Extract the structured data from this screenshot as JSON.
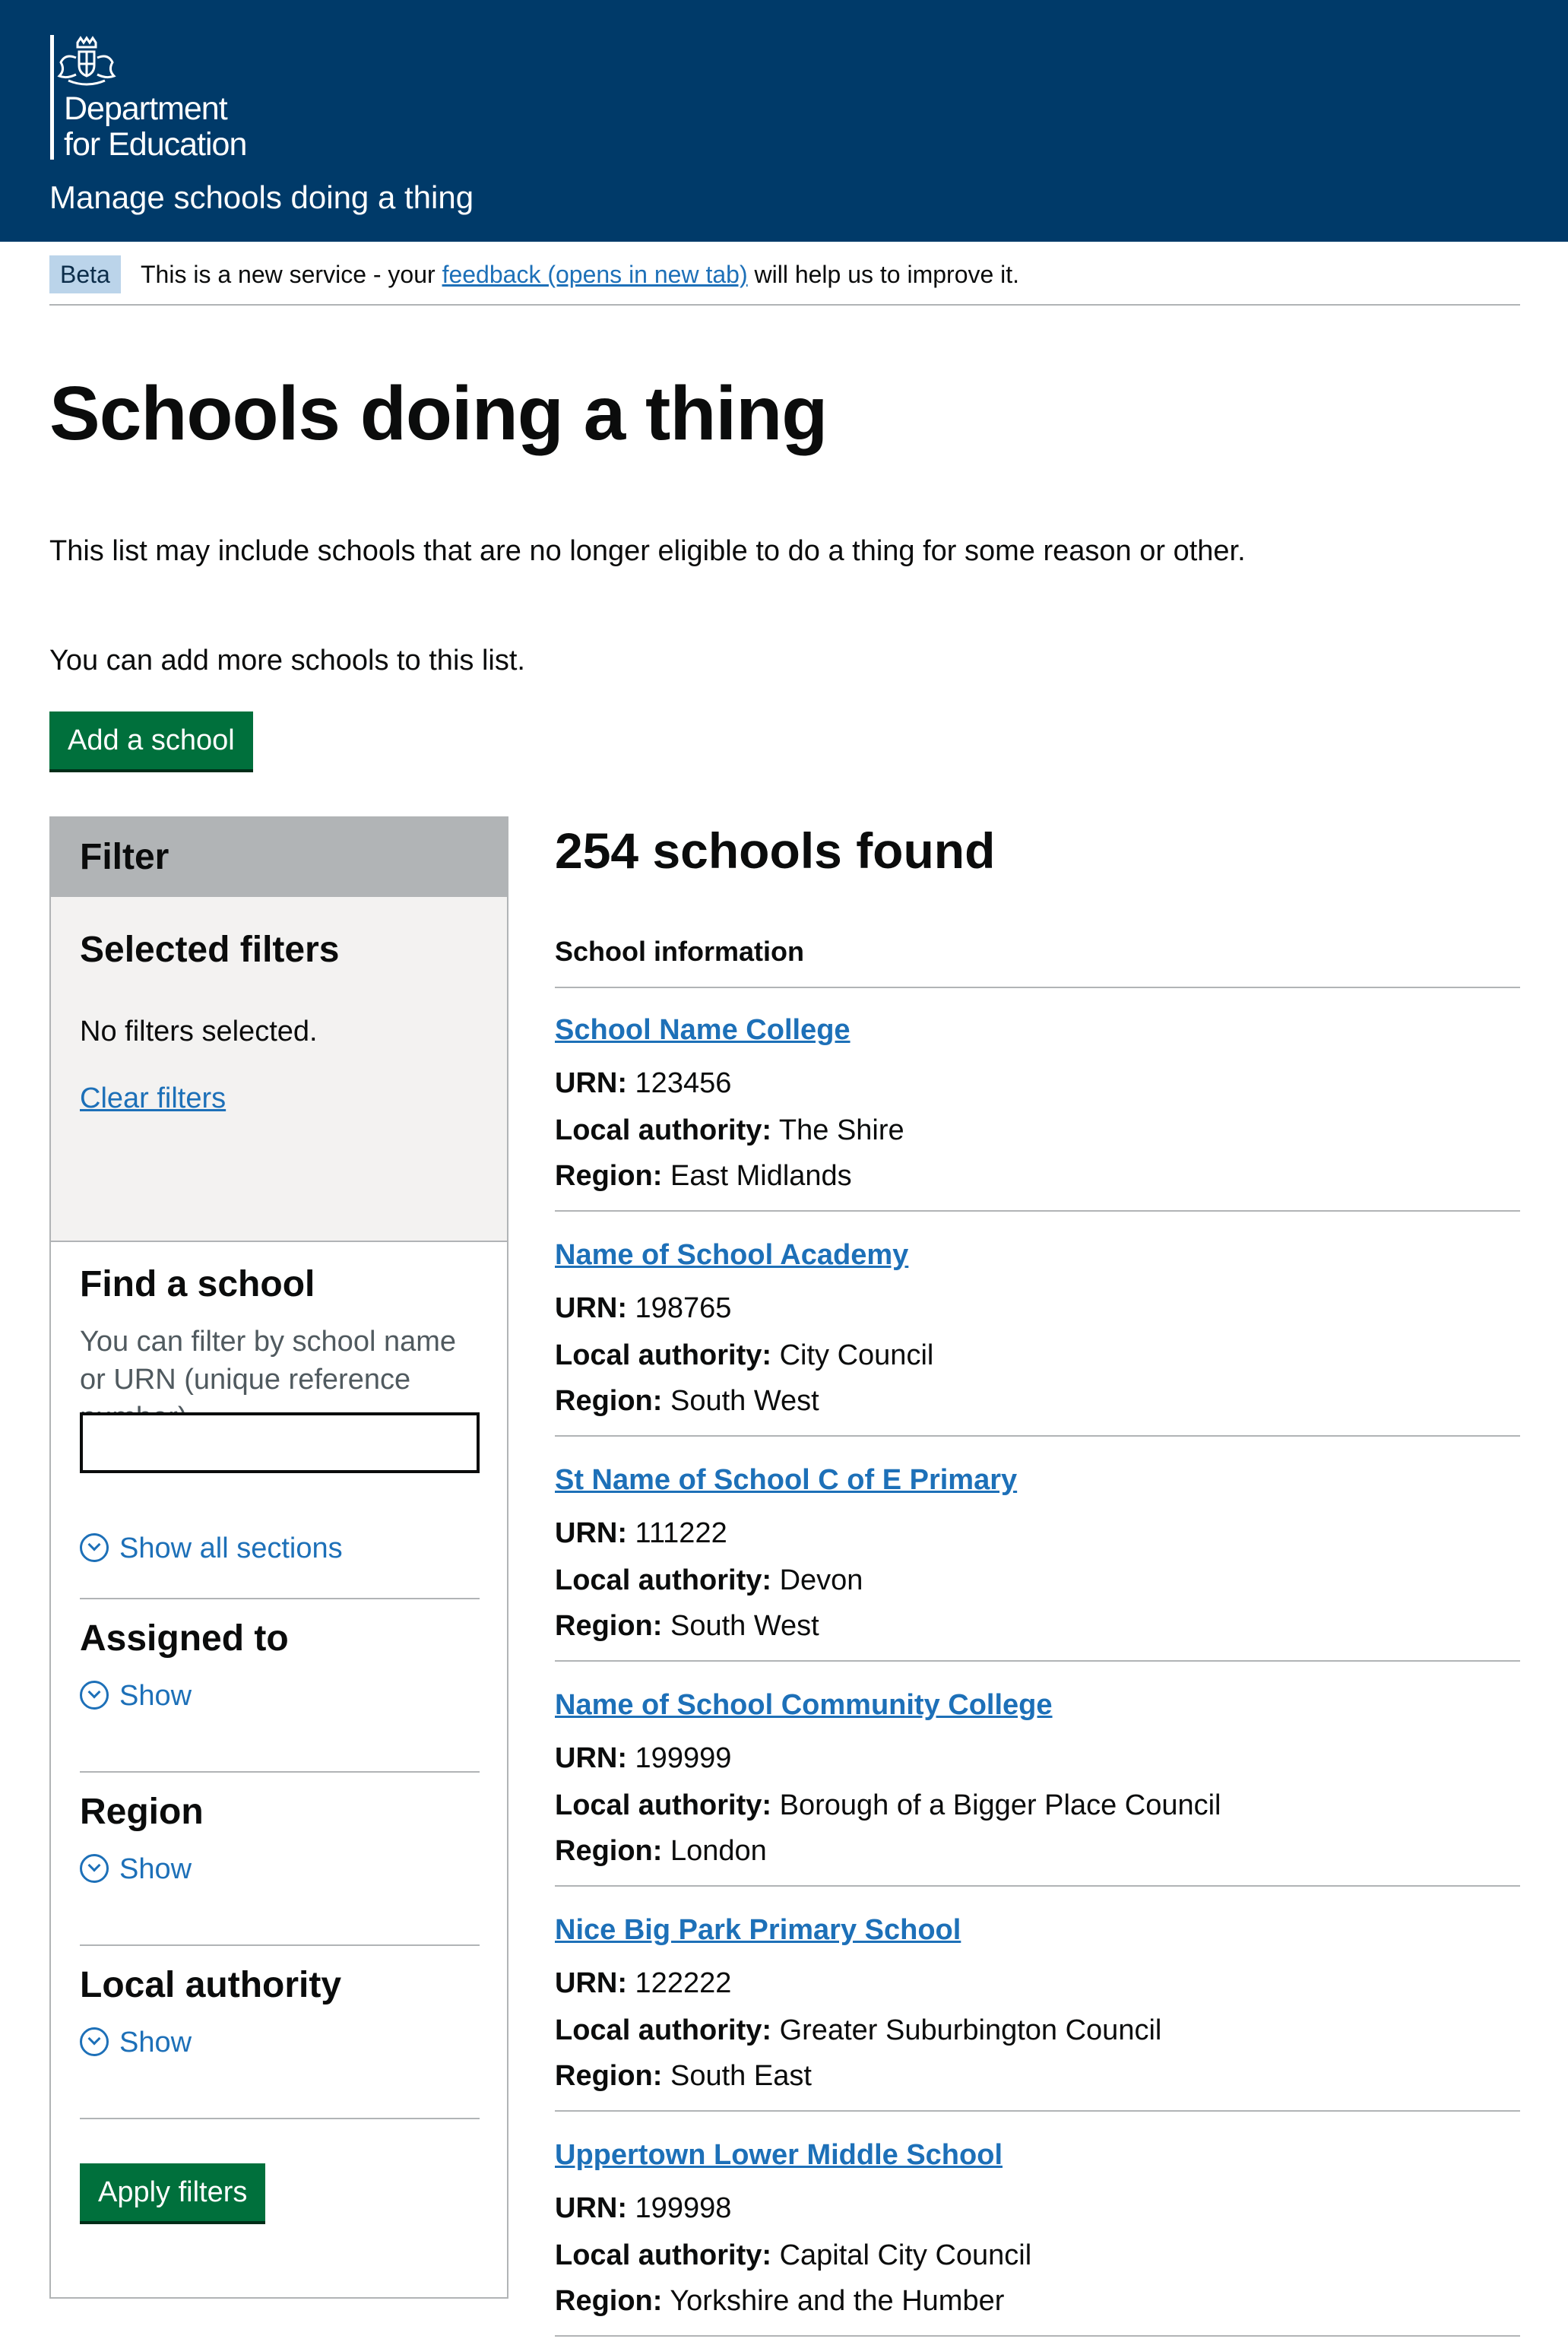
{
  "header": {
    "department_line1": "Department",
    "department_line2": "for Education",
    "service_name": "Manage schools doing a thing"
  },
  "beta": {
    "tag": "Beta",
    "text_before": "This is a new service - your ",
    "link": "feedback (opens in new tab)",
    "text_after": " will help us to improve it."
  },
  "page": {
    "title": "Schools doing a thing",
    "intro": "This list may include schools that are no longer eligible to do a thing for some reason or other.",
    "intro2": "You can add more schools to this list.",
    "add_button": "Add a school"
  },
  "filter": {
    "heading": "Filter",
    "selected_heading": "Selected filters",
    "no_filters": "No filters selected.",
    "clear_link": "Clear filters",
    "find_title": "Find a school",
    "find_hint": "You can filter by school name or URN (unique reference number).",
    "find_value": "",
    "show_all": "Show all sections",
    "sections": [
      {
        "title": "Assigned to",
        "toggle": "Show"
      },
      {
        "title": "Region",
        "toggle": "Show"
      },
      {
        "title": "Local authority",
        "toggle": "Show"
      }
    ],
    "apply_button": "Apply filters"
  },
  "results": {
    "count_heading": "254 schools found",
    "column_header": "School information",
    "labels": {
      "urn": "URN:",
      "la": "Local authority:",
      "region": "Region:"
    },
    "items": [
      {
        "name": "School Name College",
        "urn": "123456",
        "la": "The Shire",
        "region": "East Midlands"
      },
      {
        "name": "Name of School Academy",
        "urn": "198765",
        "la": "City Council",
        "region": "South West"
      },
      {
        "name": "St Name of School C of E Primary",
        "urn": "111222",
        "la": "Devon",
        "region": "South West"
      },
      {
        "name": "Name of School Community College",
        "urn": "199999",
        "la": "Borough of a Bigger Place Council",
        "region": "London"
      },
      {
        "name": "Nice Big Park Primary School",
        "urn": "122222",
        "la": "Greater Suburbington Council",
        "region": "South East"
      },
      {
        "name": "Uppertown Lower Middle School",
        "urn": "199998",
        "la": "Capital City Council",
        "region": "Yorkshire and the Humber"
      }
    ]
  }
}
